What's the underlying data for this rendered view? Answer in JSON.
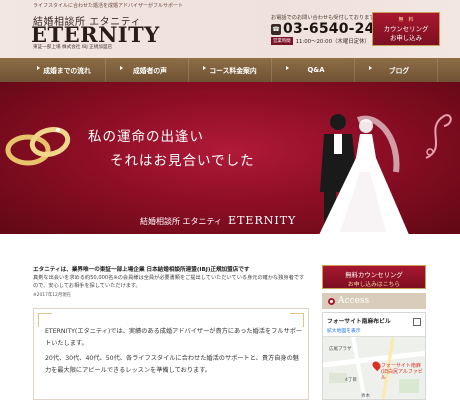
{
  "header": {
    "tagline": "ライフスタイルに合わせた婚活を成婚アドバイザーがフルサポート",
    "brand_jp": "結婚相談所 エタニティ",
    "brand_en": "ETERNITY",
    "brand_sub": "東証一部上場 株式会社 IBJ 正規加盟店",
    "phone_note": "お電話でのお問い合わせも受付しております",
    "phone": "03-6540-2414",
    "hours_tag": "営業時間",
    "hours": "11:00～20:00（木曜日定休）",
    "cta_badge": "無　料",
    "cta_line1": "カウンセリング",
    "cta_line2": "お申し込み"
  },
  "nav": {
    "items": [
      {
        "label": "成婚までの流れ"
      },
      {
        "label": "成婚者の声"
      },
      {
        "label": "コース料金案内"
      },
      {
        "label": "Q&A"
      },
      {
        "label": "ブログ"
      }
    ]
  },
  "hero": {
    "copy_line1": "私の運命の出逢い",
    "copy_line2": "それはお見合いでした",
    "brand_jp": "結婚相談所 エタニティ",
    "brand_en": "ETERNITY"
  },
  "main": {
    "intro_heading": "エタニティは、業界唯一の東証一部上場企業 日本結婚相談所連盟(IBJ)正規加盟店です",
    "intro_body": "真剣な出会いを求める約50,000名※の会員様は全員が必要書類をご提出していただいている身元の確かな独身者ですので、安心してお相手を探していただけます。",
    "intro_date": "※2017年12月現在",
    "feature_p1": "ETERNITY(エタニティ)では、実績のある成婚アドバイザーが貴方にあった婚活をフルサポートいたします。",
    "feature_p2": "20代、30代、40代、50代、各ライフスタイルに合わせた婚活のサポートと、貴方自身の魅力を最大限にアピールできるレッスンを準備しております。"
  },
  "sidebar": {
    "cta_line1": "無料カウンセリング",
    "cta_line2": "お申し込みはこちら",
    "access_label": "Access",
    "map": {
      "title": "フォーサイト南麻布ビル",
      "link": "拡大地図を表示",
      "place_line1": "フォーサイト南麻",
      "place_line2": "(旧白尻アルファビル",
      "labels": [
        "広尾プラザ",
        "4丁目",
        "青木"
      ]
    }
  },
  "colors": {
    "accent": "#8e0e26",
    "nav": "#7d5e3c",
    "gold": "#c9a15a"
  }
}
